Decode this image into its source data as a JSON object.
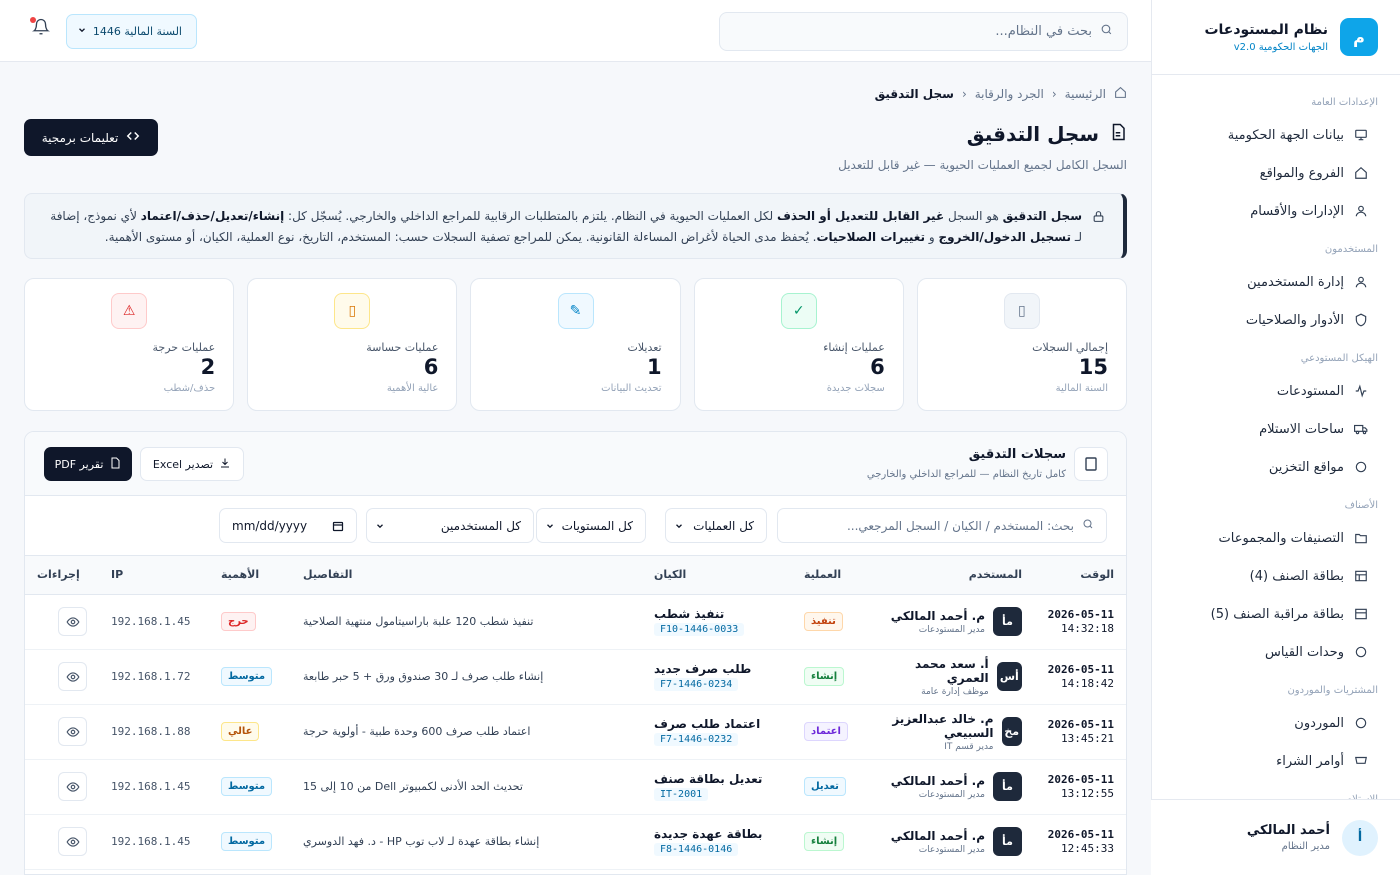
{
  "brand": {
    "logo": "م",
    "title": "نظام المستودعات",
    "subtitle": "الجهات الحكومية v2.0"
  },
  "sidebar": {
    "sections": [
      {
        "title": "الإعدادات العامة",
        "items": [
          {
            "label": "بيانات الجهة الحكومية",
            "icon": "monitor-icon"
          },
          {
            "label": "الفروع والمواقع",
            "icon": "home-icon"
          },
          {
            "label": "الإدارات والأقسام",
            "icon": "user-icon"
          }
        ]
      },
      {
        "title": "المستخدمون",
        "items": [
          {
            "label": "إدارة المستخدمين",
            "icon": "user-icon"
          },
          {
            "label": "الأدوار والصلاحيات",
            "icon": "shield-icon"
          }
        ]
      },
      {
        "title": "الهيكل المستودعي",
        "items": [
          {
            "label": "المستودعات",
            "icon": "activity-icon"
          },
          {
            "label": "ساحات الاستلام",
            "icon": "truck-icon"
          },
          {
            "label": "مواقع التخزين",
            "icon": "circle-icon"
          }
        ]
      },
      {
        "title": "الأصناف",
        "items": [
          {
            "label": "التصنيفات والمجموعات",
            "icon": "folder-icon"
          },
          {
            "label": "بطاقة الصنف (4)",
            "icon": "table-icon"
          },
          {
            "label": "بطاقة مراقبة الصنف (5)",
            "icon": "layout-icon"
          },
          {
            "label": "وحدات القياس",
            "icon": "circle-icon"
          }
        ]
      },
      {
        "title": "المشتريات والموردون",
        "items": [
          {
            "label": "الموردون",
            "icon": "circle-icon"
          },
          {
            "label": "أوامر الشراء",
            "icon": "cart-icon"
          }
        ]
      },
      {
        "title": "الاستلام",
        "items": []
      }
    ]
  },
  "user": {
    "avatar": "أ",
    "name": "أحمد المالكي",
    "role": "مدير النظام"
  },
  "topbar": {
    "search_placeholder": "بحث في النظام...",
    "year_label": "السنة المالية 1446"
  },
  "breadcrumb": {
    "home": "الرئيسية",
    "parent": "الجرد والرقابة",
    "current": "سجل التدقيق"
  },
  "page": {
    "title": "سجل التدقيق",
    "subtitle": "السجل الكامل لجميع العمليات الحيوية — غير قابل للتعديل",
    "dev_button": "تعليمات برمجية"
  },
  "notice": {
    "p1": "سجل التدقيق",
    "p2": " هو السجل ",
    "p3": "غير القابل للتعديل أو الحذف",
    "p4": " لكل العمليات الحيوية في النظام. يلتزم بالمتطلبات الرقابية للمراجع الداخلي والخارجي. يُسجّل كل: ",
    "p5": "إنشاء/تعديل/حذف/اعتماد",
    "p6": " لأي نموذج، إضافة لـ ",
    "p7": "تسجيل الدخول/الخروج",
    "p8": " و ",
    "p9": "تغييرات الصلاحيات",
    "p10": ". يُحفظ مدى الحياة لأغراض المساءلة القانونية. يمكن للمراجع تصفية السجلات حسب: المستخدم، التاريخ، نوع العملية، الكيان، أو مستوى الأهمية."
  },
  "stats": [
    {
      "label": "إجمالي السجلات",
      "value": "15",
      "note": "السنة المالية",
      "icon": "file-icon",
      "bg": "#f1f5f9",
      "border": "#e2e8f0",
      "color": "#64748b",
      "glyph": "▯"
    },
    {
      "label": "عمليات إنشاء",
      "value": "6",
      "note": "سجلات جديدة",
      "icon": "check-icon",
      "bg": "#ecfdf5",
      "border": "#a7f3d0",
      "color": "#059669",
      "glyph": "✓"
    },
    {
      "label": "تعديلات",
      "value": "1",
      "note": "تحديث البيانات",
      "icon": "edit-icon",
      "bg": "#f0f9ff",
      "border": "#bae6fd",
      "color": "#0284c7",
      "glyph": "✎"
    },
    {
      "label": "عمليات حساسة",
      "value": "6",
      "note": "عالية الأهمية",
      "icon": "sensitive-icon",
      "bg": "#fffbeb",
      "border": "#fde68a",
      "color": "#d97706",
      "glyph": "▯"
    },
    {
      "label": "عمليات حرجة",
      "value": "2",
      "note": "حذف/شطب",
      "icon": "warning-icon",
      "bg": "#fef2f2",
      "border": "#fecaca",
      "color": "#dc2626",
      "glyph": "⚠"
    }
  ],
  "panel": {
    "title": "سجلات التدقيق",
    "subtitle": "كامل تاريخ النظام — للمراجع الداخلي والخارجي",
    "pdf_label": "تقرير PDF",
    "excel_label": "تصدير Excel"
  },
  "filters": {
    "search_placeholder": "بحث: المستخدم / الكيان / السجل المرجعي...",
    "operations": "كل العمليات",
    "levels": "كل المستويات",
    "users": "كل المستخدمين",
    "date": "mm/dd/yyyy"
  },
  "table": {
    "headers": {
      "time": "الوقت",
      "user": "المستخدم",
      "op": "العملية",
      "entity": "الكيان",
      "details": "التفاصيل",
      "importance": "الأهمية",
      "ip": "IP",
      "actions": "إجراءات"
    },
    "rows": [
      {
        "date": "2026-05-11",
        "time": "14:32:18",
        "avatar": "مأ",
        "user": "م. أحمد المالكي",
        "role": "مدير المستودعات",
        "op": "تنفيذ",
        "op_color": "#c2410c",
        "op_bg": "#fff7ed",
        "op_border": "#fed7aa",
        "entity": "تنفيذ شطب",
        "ref": "F10-1446-0033",
        "details": "تنفيذ شطب 120 علبة باراسيتامول منتهية الصلاحية",
        "imp": "حرج",
        "imp_color": "#dc2626",
        "imp_bg": "#fef2f2",
        "imp_border": "#fecaca",
        "ip": "192.168.1.45"
      },
      {
        "date": "2026-05-11",
        "time": "14:18:42",
        "avatar": "أس",
        "user": "أ. سعد محمد العمري",
        "role": "موظف إدارة عامة",
        "op": "إنشاء",
        "op_color": "#15803d",
        "op_bg": "#f0fdf4",
        "op_border": "#bbf7d0",
        "entity": "طلب صرف جديد",
        "ref": "F7-1446-0234",
        "details": "إنشاء طلب صرف لـ 30 صندوق ورق + 5 حبر طابعة",
        "imp": "متوسط",
        "imp_color": "#0369a1",
        "imp_bg": "#f0f9ff",
        "imp_border": "#bae6fd",
        "ip": "192.168.1.72"
      },
      {
        "date": "2026-05-11",
        "time": "13:45:21",
        "avatar": "مخ",
        "user": "م. خالد عبدالعزيز السبيعي",
        "role": "مدير قسم IT",
        "op": "اعتماد",
        "op_color": "#6d28d9",
        "op_bg": "#f5f3ff",
        "op_border": "#ddd6fe",
        "entity": "اعتماد طلب صرف",
        "ref": "F7-1446-0232",
        "details": "اعتماد طلب صرف 600 وحدة طبية - أولوية حرجة",
        "imp": "عالي",
        "imp_color": "#b45309",
        "imp_bg": "#fffbeb",
        "imp_border": "#fde68a",
        "ip": "192.168.1.88"
      },
      {
        "date": "2026-05-11",
        "time": "13:12:55",
        "avatar": "مأ",
        "user": "م. أحمد المالكي",
        "role": "مدير المستودعات",
        "op": "تعديل",
        "op_color": "#0369a1",
        "op_bg": "#f0f9ff",
        "op_border": "#bae6fd",
        "entity": "تعديل بطاقة صنف",
        "ref": "IT-2001",
        "details": "تحديث الحد الأدنى لكمبيوتر Dell من 10 إلى 15",
        "imp": "متوسط",
        "imp_color": "#0369a1",
        "imp_bg": "#f0f9ff",
        "imp_border": "#bae6fd",
        "ip": "192.168.1.45"
      },
      {
        "date": "2026-05-11",
        "time": "12:45:33",
        "avatar": "مأ",
        "user": "م. أحمد المالكي",
        "role": "مدير المستودعات",
        "op": "إنشاء",
        "op_color": "#15803d",
        "op_bg": "#f0fdf4",
        "op_border": "#bbf7d0",
        "entity": "بطاقة عهدة جديدة",
        "ref": "F8-1446-0146",
        "details": "إنشاء بطاقة عهدة لـ لاب توب HP - د. فهد الدوسري",
        "imp": "متوسط",
        "imp_color": "#0369a1",
        "imp_bg": "#f0f9ff",
        "imp_border": "#bae6fd",
        "ip": "192.168.1.45"
      }
    ]
  }
}
